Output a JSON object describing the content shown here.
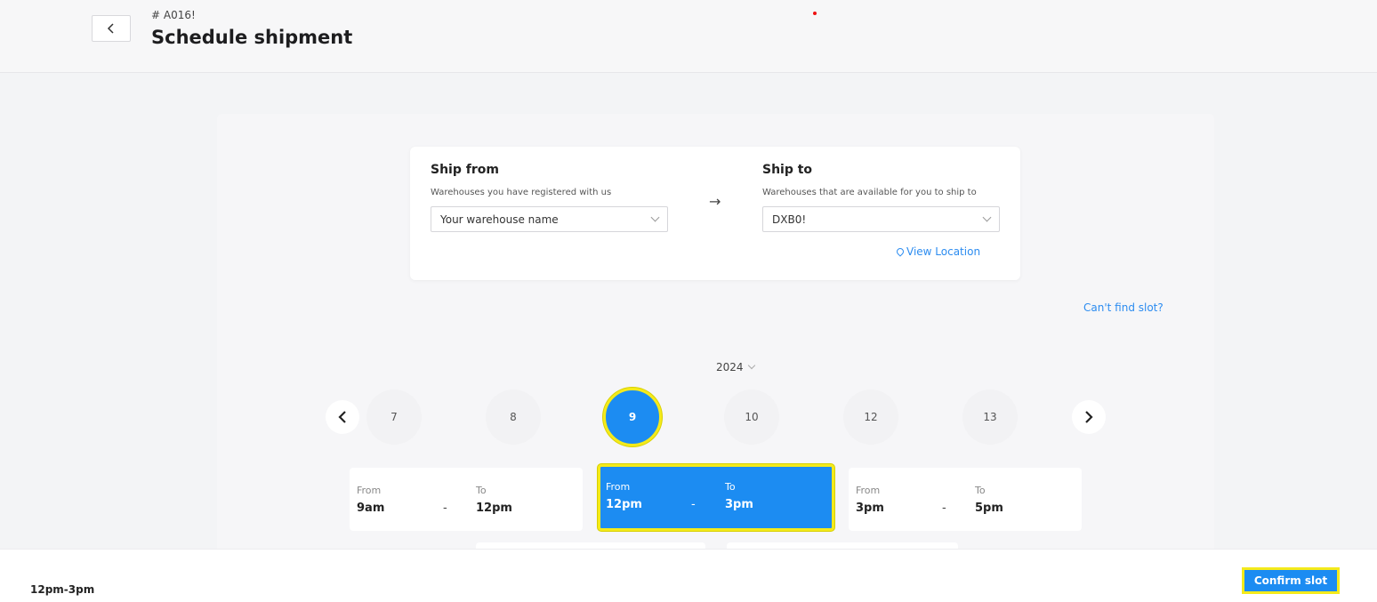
{
  "header": {
    "order_id": "# A016!",
    "title": "Schedule shipment",
    "back_icon": "chevron-left-icon"
  },
  "ship_from": {
    "title": "Ship from",
    "subtitle": "Warehouses you have registered with us",
    "selected": "Your warehouse name"
  },
  "ship_to": {
    "title": "Ship to",
    "subtitle": "Warehouses that are available for you to ship to",
    "selected": "DXB0!",
    "view_location": "View Location"
  },
  "cant_find_slot": "Can't find slot?",
  "calendar": {
    "year": "2024",
    "days": [
      "7",
      "8",
      "9",
      "10",
      "12",
      "13"
    ],
    "selected_day": "9"
  },
  "slots": [
    {
      "from_label": "From",
      "from": "9am",
      "to_label": "To",
      "to": "12pm",
      "selected": false
    },
    {
      "from_label": "From",
      "from": "12pm",
      "to_label": "To",
      "to": "3pm",
      "selected": true
    },
    {
      "from_label": "From",
      "from": "3pm",
      "to_label": "To",
      "to": "5pm",
      "selected": false
    }
  ],
  "slot_separator": "-",
  "footer": {
    "selected_slot": "12pm-3pm",
    "confirm_label": "Confirm slot"
  },
  "colors": {
    "primary": "#1c8cf2",
    "highlight": "#f4ea1b",
    "link": "#2c8cf0"
  }
}
